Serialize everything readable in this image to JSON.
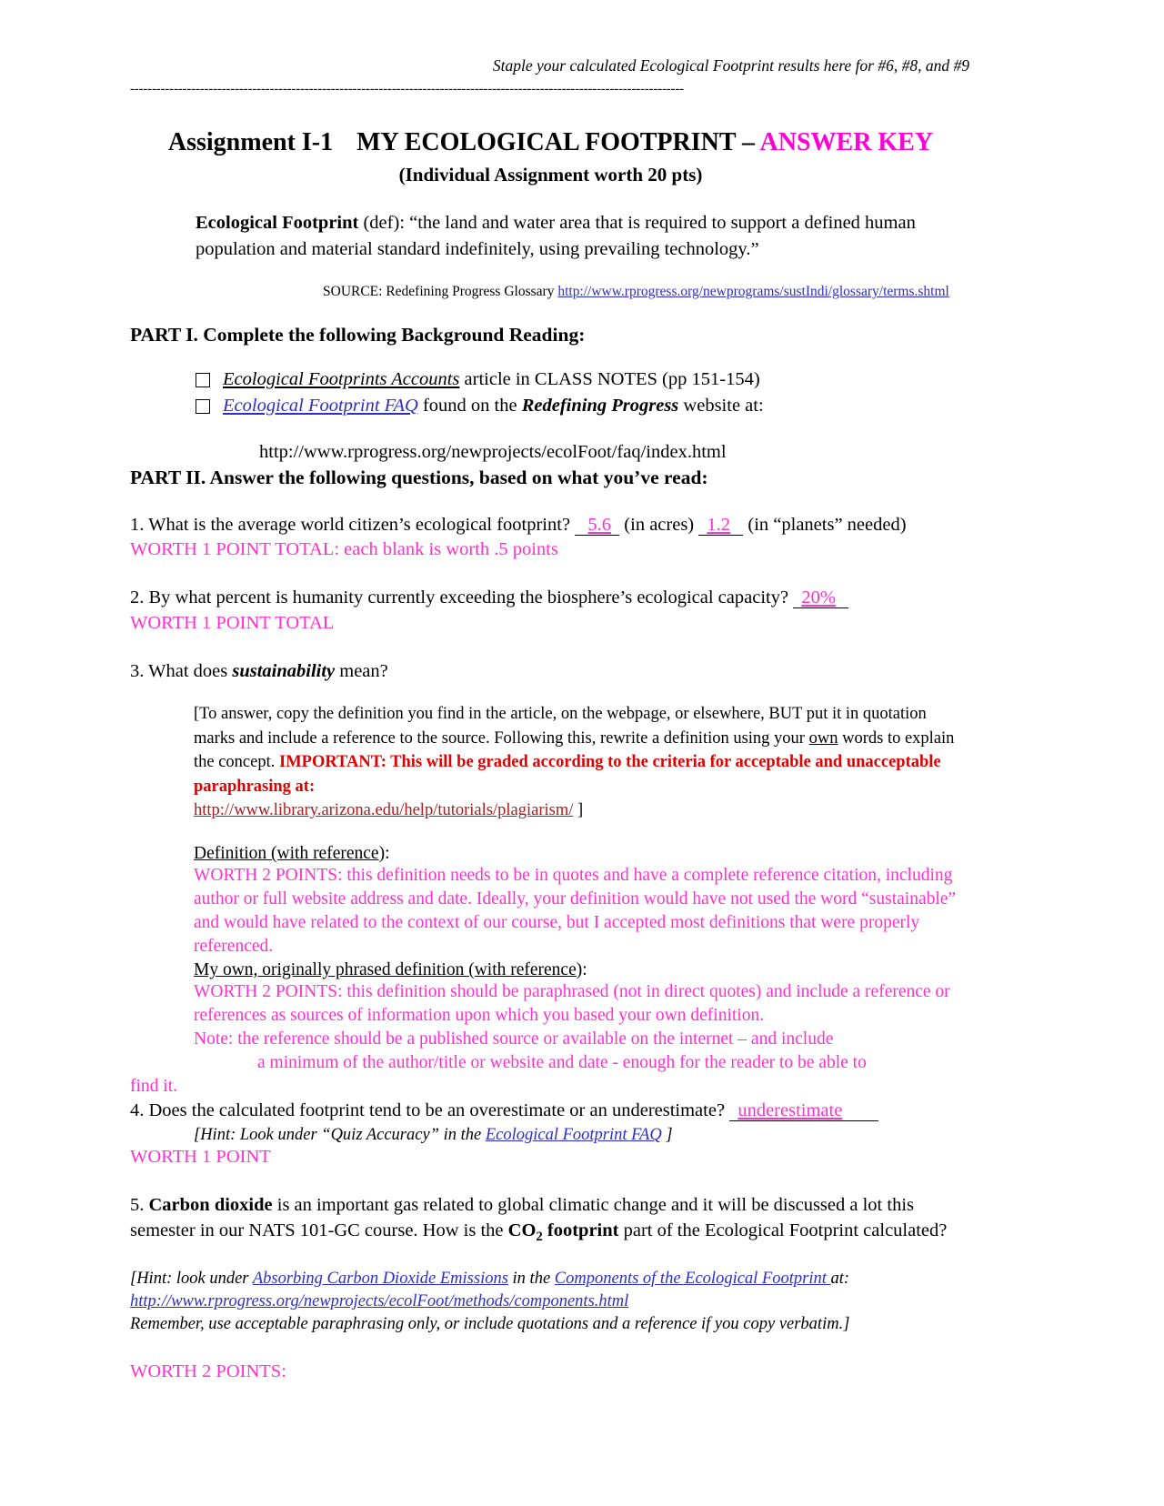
{
  "header": {
    "staple_note": "Staple your calculated Ecological Footprint results here for #6, #8, and #9",
    "rule": "-------------------------------------------------------------------------------------------------------------------------------"
  },
  "title": {
    "assignment_label": "Assignment I-1",
    "main": "MY ECOLOGICAL FOOTPRINT – ",
    "answer_key": "ANSWER KEY",
    "subtitle": "(Individual Assignment worth 20 pts)"
  },
  "definition": {
    "term": "Ecological Footprint",
    "def_label": " (def):  “the land and water area that is required to support a defined human population and material standard indefinitely, using prevailing technology.”",
    "source_label": "SOURCE:  Redefining Progress Glossary ",
    "source_url": "http://www.rprogress.org/newprograms/sustIndi/glossary/terms.shtml"
  },
  "part1": {
    "heading": "PART I.  Complete the following Background Reading:",
    "item1_title": "Ecological Footprints Accounts",
    "item1_rest": " article in CLASS NOTES (pp 151-154)",
    "item2_title": "Ecological Footprint FAQ",
    "item2_mid": "  found on the ",
    "item2_bold": "Redefining Progress",
    "item2_end": " website at:",
    "faq_url": "http://www.rprogress.org/newprojects/ecolFoot/faq/index.html"
  },
  "part2": {
    "heading": "PART  II.  Answer the following questions, based on what you’ve read:"
  },
  "q1": {
    "text": "1. What is the average world citizen’s ecological footprint? ",
    "answer_acres": "5.6",
    "mid": " (in acres)  ",
    "answer_planets": "1.2",
    "tail": " (in “planets” needed)",
    "worth": "WORTH 1 POINT TOTAL: each blank is worth .5 points"
  },
  "q2": {
    "text": "2. By what percent is humanity currently exceeding the biosphere’s ecological capacity? ",
    "answer": "20%",
    "worth": "WORTH 1 POINT TOTAL"
  },
  "q3": {
    "text_pre": "3. What does ",
    "text_em": "sustainability",
    "text_post": " mean?",
    "bracket_line1": " [To answer, copy the definition you find in the article, on the webpage, or elsewhere, BUT put it in quotation marks and include a reference to the source.  Following this, rewrite a definition using your ",
    "bracket_own": "own",
    "bracket_line2": " words to explain the concept. ",
    "important_red": "IMPORTANT:  This will be graded according to the criteria for acceptable and unacceptable paraphrasing at:",
    "plagiarism_url": "http://www.library.arizona.edu/help/tutorials/plagiarism/",
    "bracket_close": " ]",
    "def_heading_a": "Definition (with reference",
    "def_heading_b": "):",
    "def_answer": "WORTH 2 POINTS: this definition needs to be in quotes and have a complete reference citation, including author or full website address and date. Ideally, your definition would have not used the word “sustainable” and would have related to the context of our course, but I accepted most definitions that were properly referenced.",
    "own_heading_a": "My own, originally phrased definition (with reference",
    "own_heading_b": "):",
    "own_answer_1": "WORTH 2 POINTS: this definition should be paraphrased (not in direct quotes) and include a reference or references as sources of information upon which you based your own definition.",
    "own_answer_2": "Note:  the reference should be a published source or available on the internet – and include",
    "own_answer_3": "a minimum of the author/title or website and date - enough for the reader to be able to",
    "own_answer_4": "find it."
  },
  "q4": {
    "text": "4. Does the calculated footprint tend to be an overestimate or an underestimate? ",
    "answer": "underestimate",
    "hint_pre": "[Hint: Look under “Quiz Accuracy” in the ",
    "hint_link": "Ecological Footprint FAQ",
    "hint_post": " ]",
    "worth": "WORTH 1 POINT"
  },
  "q5": {
    "num": "5.  ",
    "bold_co2": "Carbon dioxide",
    "text_a": " is an important gas related to global climatic change and it will be discussed a lot this semester in our NATS 101-GC course.  How is the ",
    "bold_footprint_co": "CO",
    "bold_footprint_2": "2",
    "bold_footprint_word": " footprint",
    "text_b": " part of the Ecological Footprint calculated?",
    "hint_pre": "[Hint:  look under ",
    "hint_link1": "Absorbing Carbon Dioxide Emissions",
    "hint_mid": " in the ",
    "hint_link2": "Components of the Ecological Footprint ",
    "hint_at": " at:",
    "hint_url": "http://www.rprogress.org/newprojects/ecolFoot/methods/components.html",
    "hint_remember": " Remember, use acceptable paraphrasing only, or include quotations and a reference if you copy verbatim.]",
    "worth": "WORTH 2 POINTS:"
  },
  "colors": {
    "answer_magenta": "#ff2fd0",
    "title_magenta": "#ff00d4",
    "important_red": "#e00000",
    "hyperlink_blue": "#2d2dcc",
    "hyperlink_maroon": "#b01a1a"
  }
}
